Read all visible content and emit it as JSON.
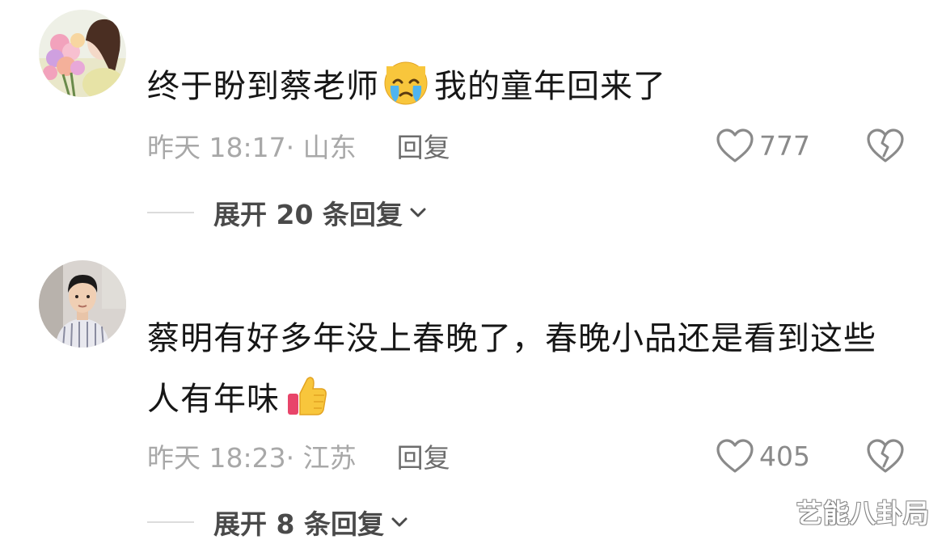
{
  "comments": [
    {
      "text": "终于盼到蔡老师",
      "emoji": "crying-face-icon",
      "text_after": "我的童年回来了",
      "meta": "昨天 18:17· 山东",
      "reply_label": "回复",
      "likes": "777",
      "expand_label": "展开 20 条回复"
    },
    {
      "text": "蔡明有好多年没上春晚了，春晚小品还是看到这些人有年味",
      "emoji": "thumbs-up-icon",
      "meta": "昨天 18:23· 江苏",
      "reply_label": "回复",
      "likes": "405",
      "expand_label": "展开 8 条回复"
    }
  ],
  "watermark": "艺能八卦局",
  "colors": {
    "text": "#161616",
    "meta": "#a8a8a8",
    "icon": "#8a8a8a"
  }
}
